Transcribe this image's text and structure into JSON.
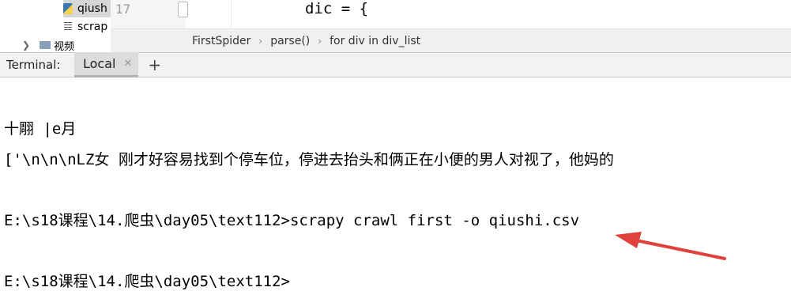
{
  "project_tree": {
    "items": [
      {
        "label": "qiush",
        "icon": "python-file-icon",
        "selected": true
      },
      {
        "label": "scrap",
        "icon": "text-file-icon",
        "selected": false
      },
      {
        "label": "视频",
        "icon": "folder-icon",
        "selected": false
      }
    ]
  },
  "editor": {
    "line_number": "17",
    "code_line": "dic = {"
  },
  "breadcrumb": [
    "FirstSpider",
    "parse()",
    "for div in div_list"
  ],
  "terminal": {
    "label": "Terminal:",
    "tab_name": "Local",
    "lines": [
      "十翢 |e月",
      "['\\n\\n\\nLZ女 刚才好容易找到个停车位，停进去抬头和俩正在小便的男人对视了，他妈的",
      "E:\\s18课程\\14.爬虫\\day05\\text112>scrapy crawl first -o qiushi.csv",
      "E:\\s18课程\\14.爬虫\\day05\\text112>"
    ]
  },
  "annotation": {
    "color": "#e0413a"
  }
}
